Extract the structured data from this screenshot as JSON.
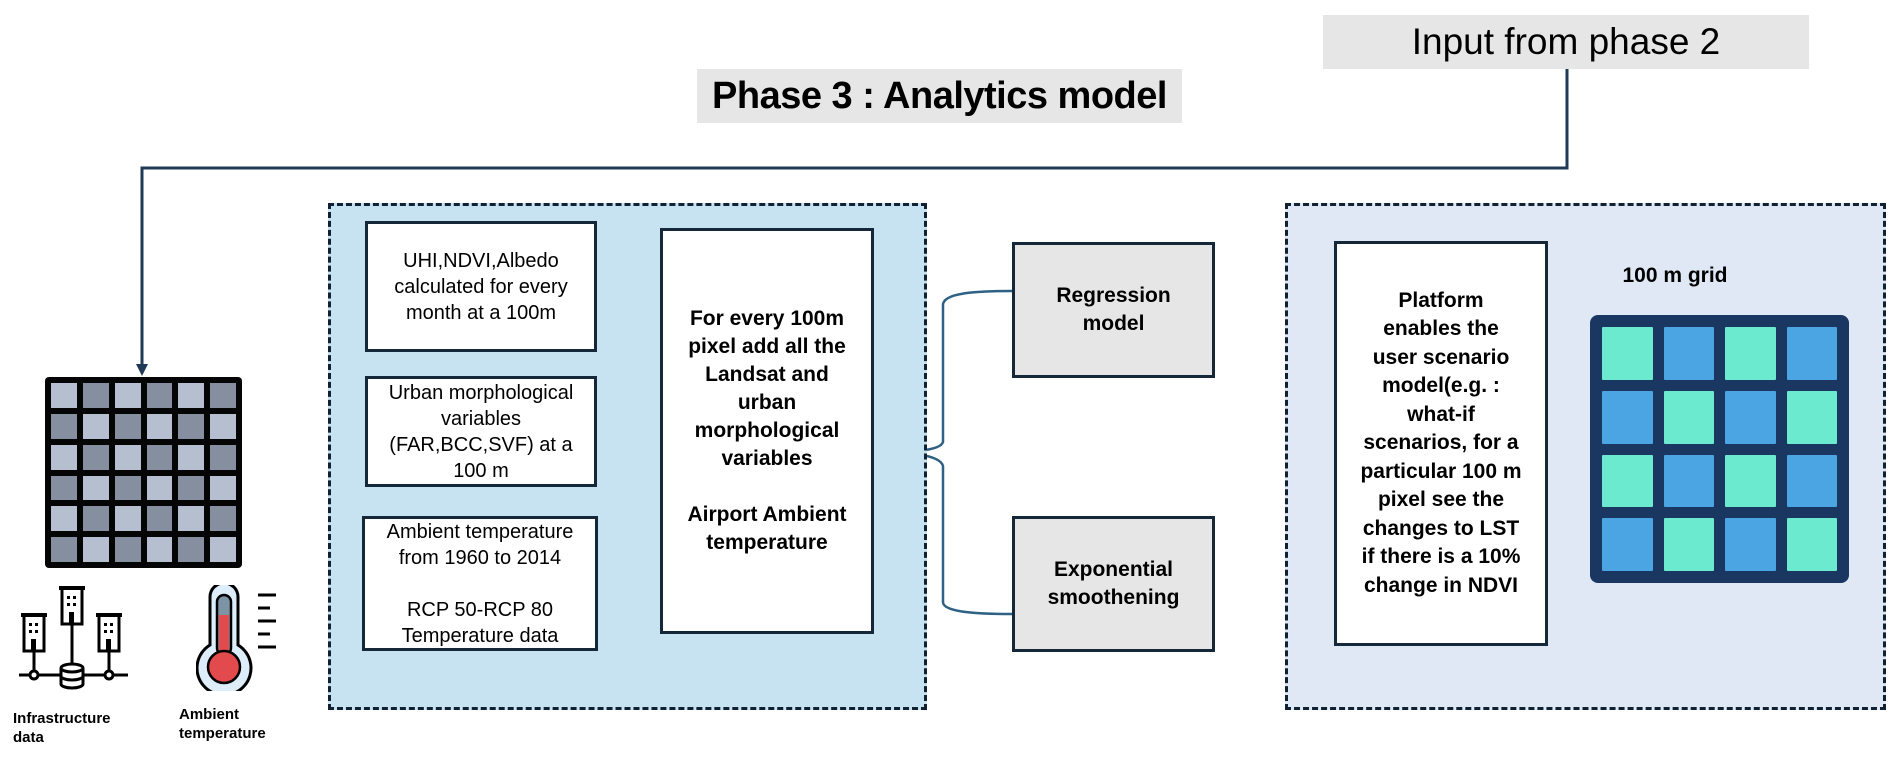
{
  "header": {
    "phase_title": "Phase 3 : Analytics model",
    "input_label": "Input from phase 2"
  },
  "inputs": {
    "infrastructure_caption": "Infrastructure\ndata",
    "ambient_caption": "Ambient\ntemperature",
    "infrastructure_icon": "buildings-database-icon",
    "ambient_icon": "thermometer-icon",
    "grid_icon": "pixel-grid-icon"
  },
  "left_panel": {
    "data_boxes": [
      "UHI,NDVI,Albedo\ncalculated for every\nmonth at a 100m",
      "Urban morphological\nvariables\n(FAR,BCC,SVF) at a\n100 m",
      "Ambient temperature\nfrom 1960 to 2014\n\nRCP 50-RCP 80\nTemperature data"
    ],
    "aggregation_box": "For every 100m\npixel add all the\nLandsat and\nurban\nmorphological\nvariables\n\nAirport Ambient\ntemperature"
  },
  "models": [
    "Regression\nmodel",
    "Exponential\nsmoothening"
  ],
  "right_panel": {
    "platform_text": "Platform\nenables the\nuser scenario\nmodel(e.g. :\nwhat-if\nscenarios, for a\nparticular 100 m\npixel see the\nchanges to LST\nif there is a 10%\nchange in NDVI",
    "grid_label": "100 m grid"
  },
  "colors": {
    "connector": "#1f3a55",
    "bracket": "#2f6184",
    "teal_cell": "#6ceacf",
    "blue_cell": "#4aa5e2",
    "grid_frame": "#193760",
    "gray_light": "#b6bfd0",
    "gray_dark": "#868f9f",
    "thermo_red": "#e34a4e"
  }
}
